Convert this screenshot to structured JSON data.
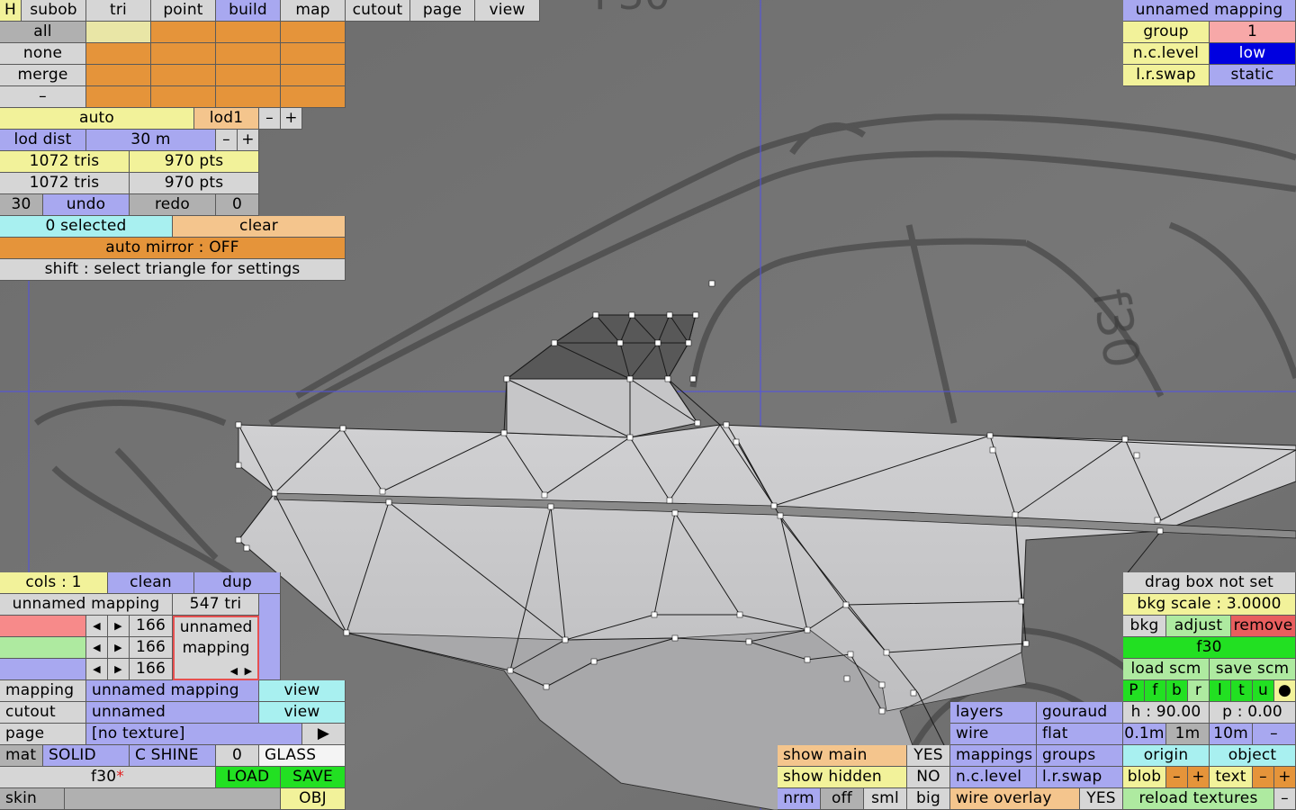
{
  "top_tabs": [
    "H",
    "subob",
    "tri",
    "point",
    "build",
    "map",
    "cutout",
    "page",
    "view"
  ],
  "select_rows": [
    "all",
    "none",
    "merge",
    "–"
  ],
  "lod": {
    "mode": "auto",
    "level": "lod1",
    "minus": "–",
    "plus": "+"
  },
  "lod_dist": {
    "label": "lod dist",
    "value": "30 m",
    "minus": "–",
    "plus": "+"
  },
  "counts": {
    "tris_a": "1072 tris",
    "pts_a": "970 pts",
    "tris_b": "1072 tris",
    "pts_b": "970 pts"
  },
  "undo_row": {
    "left_num": "30",
    "undo": "undo",
    "redo": "redo",
    "right_num": "0"
  },
  "selection": {
    "selected": "0 selected",
    "clear": "clear"
  },
  "auto_mirror": "auto mirror : OFF",
  "hint": "shift : select triangle for settings",
  "mapping_panel": {
    "title": "unnamed mapping",
    "group_label": "group",
    "group_value": "1",
    "nclevel_label": "n.c.level",
    "nclevel_value": "low",
    "lrswap_label": "l.r.swap",
    "lrswap_value": "static"
  },
  "material": {
    "cols": "cols : 1",
    "clean": "clean",
    "dup": "dup",
    "name": "unnamed mapping",
    "tri_count": "547 tri",
    "channels": [
      "166",
      "166",
      "166"
    ],
    "preview_text_1": "unnamed",
    "preview_text_2": "mapping",
    "arrow_left": "◀",
    "arrow_right": "▶",
    "rows": [
      {
        "label": "mapping",
        "value": "unnamed mapping",
        "action": "view"
      },
      {
        "label": "cutout",
        "value": "unnamed",
        "action": "view"
      },
      {
        "label": "page",
        "value": "[no texture]",
        "action": "▶"
      }
    ],
    "mat_label": "mat",
    "solid": "SOLID",
    "shine": "C SHINE",
    "shine_value": "0",
    "glass": "GLASS",
    "file": "f30",
    "modified_mark": "*",
    "load": "LOAD",
    "save": "SAVE",
    "skin": "skin",
    "obj": "OBJ"
  },
  "display": {
    "show_main": "show main",
    "show_main_value": "YES",
    "show_hidden": "show hidden",
    "show_hidden_value": "NO",
    "nrm": "nrm",
    "off": "off",
    "sml": "sml",
    "big": "big",
    "layers": "layers",
    "gouraud": "gouraud",
    "wire": "wire",
    "flat": "flat",
    "mappings": "mappings",
    "groups": "groups",
    "nclevel": "n.c.level",
    "lrswap": "l.r.swap",
    "wire_overlay": "wire overlay",
    "wire_overlay_value": "YES"
  },
  "scene": {
    "drag_box": "drag box not set",
    "bkg_scale": "bkg scale : 3.0000",
    "bkg": "bkg",
    "adjust": "adjust",
    "remove": "remove",
    "name": "f30",
    "load_scm": "load scm",
    "save_scm": "save scm",
    "views": [
      "P",
      "f",
      "b",
      "r",
      "l",
      "t",
      "u",
      "●"
    ],
    "h": "h : 90.00",
    "p": "p : 0.00",
    "steps": [
      "0.1m",
      "1m",
      "10m",
      "–"
    ],
    "origin": "origin",
    "object": "object",
    "blob": "blob",
    "text": "text",
    "minus": "–",
    "plus": "+",
    "reload": "reload textures",
    "reload_minus": "–"
  },
  "colors": {
    "orange": "#e5943a",
    "yellow": "#f2f29a",
    "blue": "#a8a8f0",
    "cyan": "#a8f0f0",
    "green": "#22e022",
    "selected_blue": "#0000e0"
  }
}
